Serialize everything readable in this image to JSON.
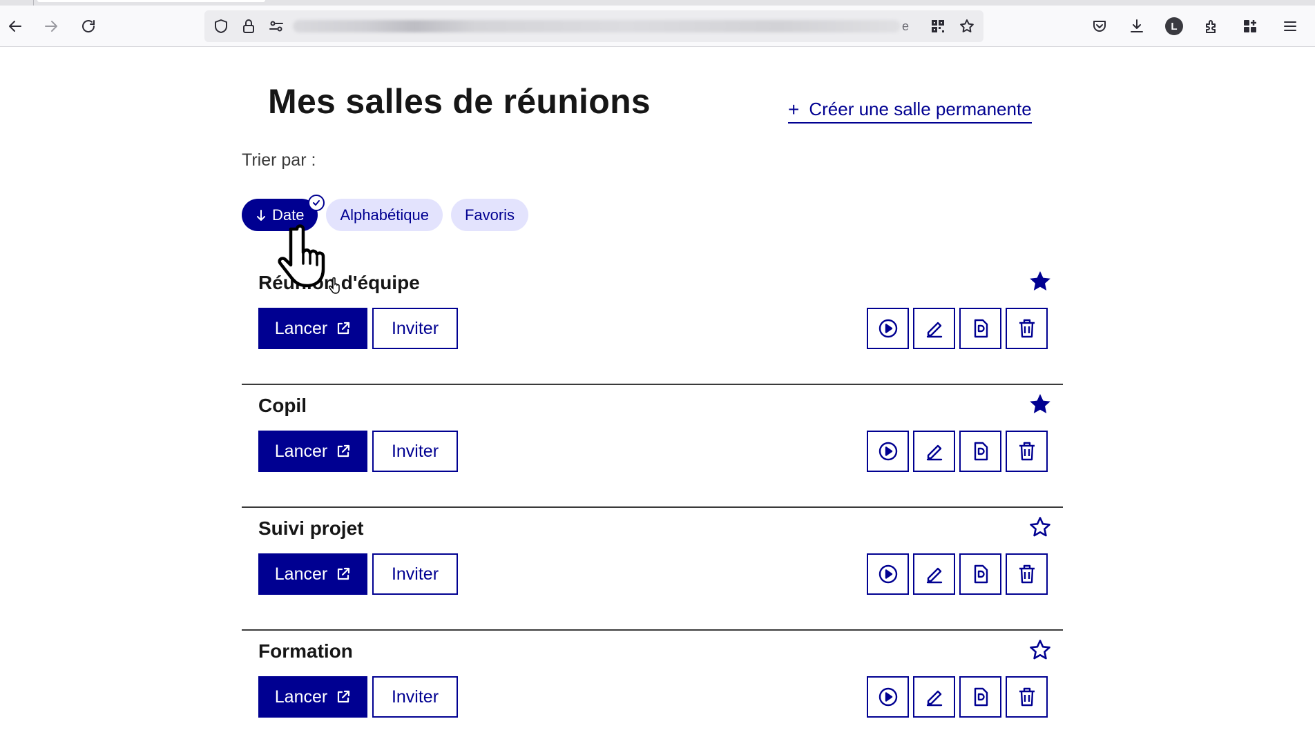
{
  "browser": {
    "url_tail": "e",
    "profile_initial": "L",
    "icons": [
      "back-icon",
      "forward-icon",
      "reload-icon",
      "shield-icon",
      "lock-icon",
      "permissions-icon",
      "qr-code-icon",
      "bookmark-star-icon",
      "pocket-icon",
      "download-icon",
      "extensions-icon",
      "apps-icon",
      "menu-icon"
    ]
  },
  "page": {
    "title": "Mes salles de réunions",
    "create_label": "Créer une salle permanente",
    "sort_label": "Trier par :"
  },
  "sort": {
    "options": [
      {
        "label": "Date",
        "selected": true
      },
      {
        "label": "Alphabétique",
        "selected": false
      },
      {
        "label": "Favoris",
        "selected": false
      }
    ]
  },
  "buttons": {
    "launch": "Lancer",
    "invite": "Inviter"
  },
  "rooms": [
    {
      "name": "Réunion d'équipe",
      "favorite": true
    },
    {
      "name": "Copil",
      "favorite": true
    },
    {
      "name": "Suivi projet",
      "favorite": false
    },
    {
      "name": "Formation",
      "favorite": false
    }
  ],
  "colors": {
    "primary": "#000091",
    "chip_bg": "#e3e3fd",
    "text": "#161616",
    "divider": "#3a3a3a"
  }
}
